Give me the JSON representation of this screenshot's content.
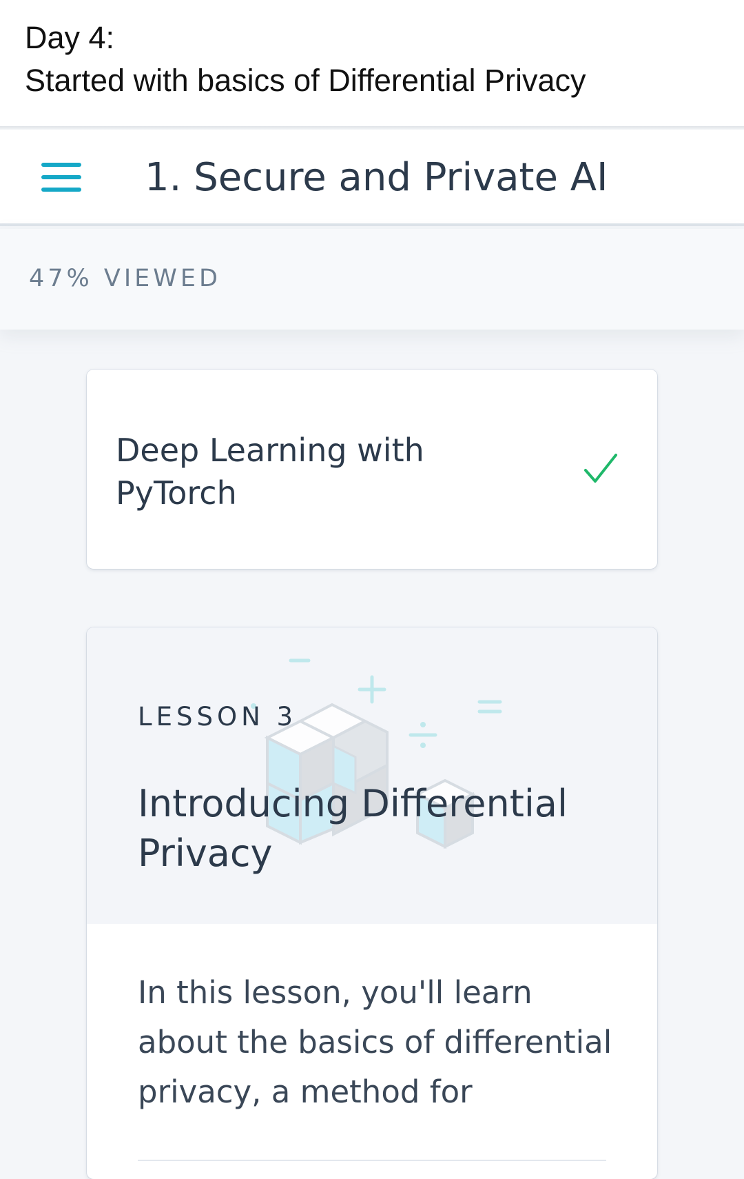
{
  "post": {
    "line1": "Day 4:",
    "line2": "Started with basics of Differential Privacy"
  },
  "header": {
    "menu_icon": "hamburger-menu-icon",
    "title": "1. Secure and Private AI",
    "accent_color": "#15a8c7"
  },
  "progress": {
    "label": "47% VIEWED",
    "percent_viewed": 47
  },
  "concepts": [
    {
      "title": "Deep Learning with PyTorch",
      "status_icon": "checkmark-icon",
      "status_color": "#1fb86a"
    }
  ],
  "lesson": {
    "label": "LESSON 3",
    "title": "Introducing Differential Privacy",
    "description": "In this lesson, you'll learn about the basics of differential privacy, a method for",
    "hero_icons": [
      "cubes-icon",
      "minus-icon",
      "plus-icon",
      "divide-icon",
      "equals-icon"
    ]
  }
}
